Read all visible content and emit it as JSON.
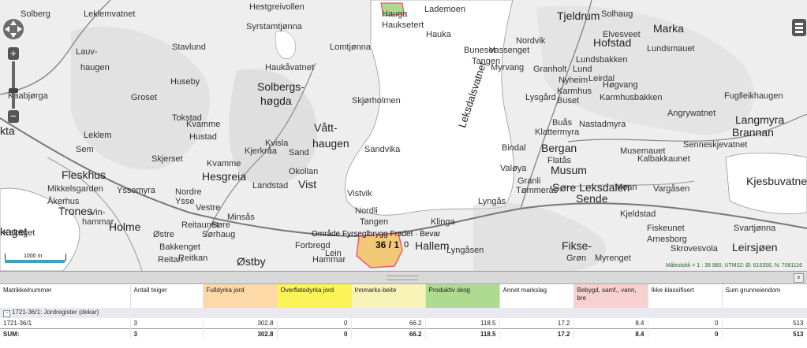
{
  "map": {
    "places": [
      "Solberg",
      "Leklemvatnet",
      "Hestgreivollen",
      "Lademoen",
      "Tjeldrum",
      "Solhaug",
      "Marka",
      "Syrstamtjønna",
      "Hauga",
      "Hauksetert",
      "Hauka",
      "Hofstad",
      "Elvesveet",
      "Lauv-",
      "haugen",
      "Stavlund",
      "Lomtjønna",
      "Buneset",
      "Tangen",
      "Vassenget",
      "Nordvik",
      "Lundsbakken",
      "Lundsmauet",
      "Haukåvatnet",
      "Myrvang",
      "Granholt",
      "Lund",
      "Leirdal",
      "Huseby",
      "Solbergs-",
      "høgda",
      "Kaabjørga",
      "Groset",
      "Nyheim",
      "Høgvang",
      "Karmhus",
      "Buset",
      "Karmhusbakken",
      "Fuglleikhaugen",
      "Skjørholmen",
      "Lysgård",
      "Tokstad",
      "Kvamme",
      "Vått-",
      "haugen",
      "Buås",
      "Klattermyra",
      "Nastadmyra",
      "Angrywatnet",
      "Langmyra",
      "Brannan",
      "Leklem",
      "Hustad",
      "Kvisla",
      "Sandvika",
      "Bergan",
      "Musemauet",
      "Senneskjevatnet",
      "Sem",
      "Skjerset",
      "Kjerkråa",
      "Sand",
      "Bindal",
      "Flatås",
      "Musum",
      "Kjesbuvatnet",
      "Fleskhus",
      "Mikkelsgarden",
      "Hesgreia",
      "Kvamme",
      "Okollan",
      "Vist",
      "Vistvik",
      "Valøya",
      "Granli",
      "Kalbakkaunet",
      "Åkerhus",
      "Yssemyra",
      "Nordre",
      "Ysse",
      "Landstad",
      "Tømmerås",
      "Søre Leksdalen",
      "Moan",
      "Vargåsen",
      "Trones",
      "Vin-",
      "hammar",
      "Vestre",
      "Minsås",
      "Nordli",
      "Tangen",
      "Lyngås",
      "Sende",
      "Kjeldstad",
      "Holme",
      "Østre",
      "Reitaunet",
      "Søre",
      "Sørhaug",
      "Hallem",
      "Klinga",
      "Fiskeunet",
      "Reitan",
      "Bakkenget",
      "Forbregd",
      "Lein",
      "Lyngåsen",
      "Arnesborg",
      "Svartjønna",
      "Kakaget",
      "Reitkan",
      "Hammar",
      "Østby",
      "Fikse-",
      "Grøn",
      "Myrenget",
      "Skrovesvola",
      "Leirsjøen"
    ],
    "lake_name": "Leksdalsvatnet",
    "big_labels": [
      "Kjesbuvatnet",
      "Bergan",
      "Musum",
      "Hesgreia",
      "Hallem",
      "Østby",
      "Fleskhus",
      "Trones",
      "Holme",
      "Hofstad",
      "Marka"
    ],
    "edge_labels": [
      "kta",
      "kaget"
    ],
    "parcel_labels": "Område Fyrseglbrygg Fradet · Bevar",
    "parcel_number": "36 / 1",
    "parcel_number2": "0",
    "scale_label": "1000 m",
    "status": "Målestokk = 1 : 39 960, UTM32: Ø: 615356, N: 7081116"
  },
  "colors": {
    "map_bg": "#eeeeee",
    "water": "#ffffff",
    "parcel_fill": "#f3c56b",
    "parcel_border": "#e84d6b",
    "fulldyrka": "#fdd9a8",
    "overflatedyrka": "#fbf35a",
    "innmarksbeite": "#f8f4b8",
    "produktiv": "#aedb8f",
    "bebygd": "#f7d1cf"
  },
  "icons": {
    "pan": "pan-control-icon",
    "zoom_in": "zoom-in-icon",
    "zoom_out": "zoom-out-icon",
    "layers": "layers-icon",
    "expand": "minus-box-icon",
    "close": "close-icon"
  },
  "controls": {
    "zoom_in": "+",
    "zoom_out": "−",
    "close": "×"
  },
  "table": {
    "headers": [
      {
        "label": "Matrikkelnummer",
        "color": ""
      },
      {
        "label": "Antall teiger",
        "color": ""
      },
      {
        "label": "Fulldyrka jord",
        "color": "#fdd9a8"
      },
      {
        "label": "Overflatedyrka jord",
        "color": "#fbf35a"
      },
      {
        "label": "Innmarks-beite",
        "color": "#f8f4b8"
      },
      {
        "label": "Produktiv skog",
        "color": "#aedb8f"
      },
      {
        "label": "Annet markslag",
        "color": ""
      },
      {
        "label": "Bebygd, samf., vann, bre",
        "color": "#f7d1cf"
      },
      {
        "label": "Ikke klassifisert",
        "color": ""
      },
      {
        "label": "Sum grunneiendom",
        "color": ""
      }
    ],
    "group_label": "1721-36/1: Jordregister (dekar)",
    "group_icon_glyph": "−",
    "rows": [
      [
        "1721-36/1",
        "3",
        "302.8",
        "0",
        "66.2",
        "118.5",
        "17.2",
        "8.4",
        "0",
        "513"
      ]
    ],
    "sum_row": [
      "SUM:",
      "3",
      "302.8",
      "0",
      "66.2",
      "118.5",
      "17.2",
      "8.4",
      "0",
      "513"
    ]
  }
}
